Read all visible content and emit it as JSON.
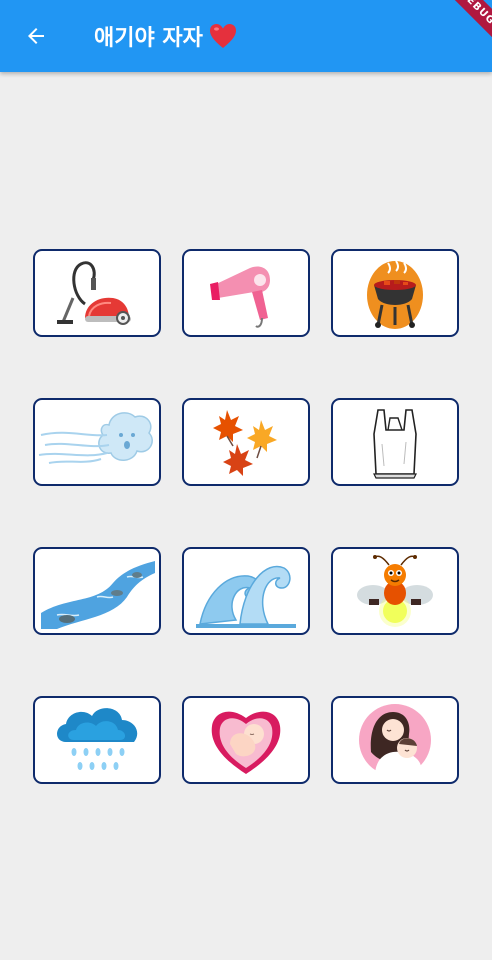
{
  "appbar": {
    "title": "애기야 자자",
    "heart_icon": "heart-icon",
    "back_icon": "arrow-left-icon",
    "background": "#2196f3",
    "debug_banner": "DEBUG"
  },
  "grid": {
    "card_border_color": "#0e2a6b",
    "items": [
      {
        "name": "vacuum-cleaner",
        "icon": "vacuum-icon"
      },
      {
        "name": "hair-dryer",
        "icon": "hair-dryer-icon"
      },
      {
        "name": "barbecue-grill",
        "icon": "grill-icon"
      },
      {
        "name": "wind",
        "icon": "wind-icon"
      },
      {
        "name": "autumn-leaves",
        "icon": "leaves-icon"
      },
      {
        "name": "plastic-bag",
        "icon": "plastic-bag-icon"
      },
      {
        "name": "river",
        "icon": "river-icon"
      },
      {
        "name": "ocean-wave",
        "icon": "wave-icon"
      },
      {
        "name": "firefly",
        "icon": "firefly-icon"
      },
      {
        "name": "rain-cloud",
        "icon": "rain-cloud-icon"
      },
      {
        "name": "baby-in-womb",
        "icon": "womb-icon"
      },
      {
        "name": "mother-and-baby",
        "icon": "mother-baby-icon"
      }
    ]
  }
}
